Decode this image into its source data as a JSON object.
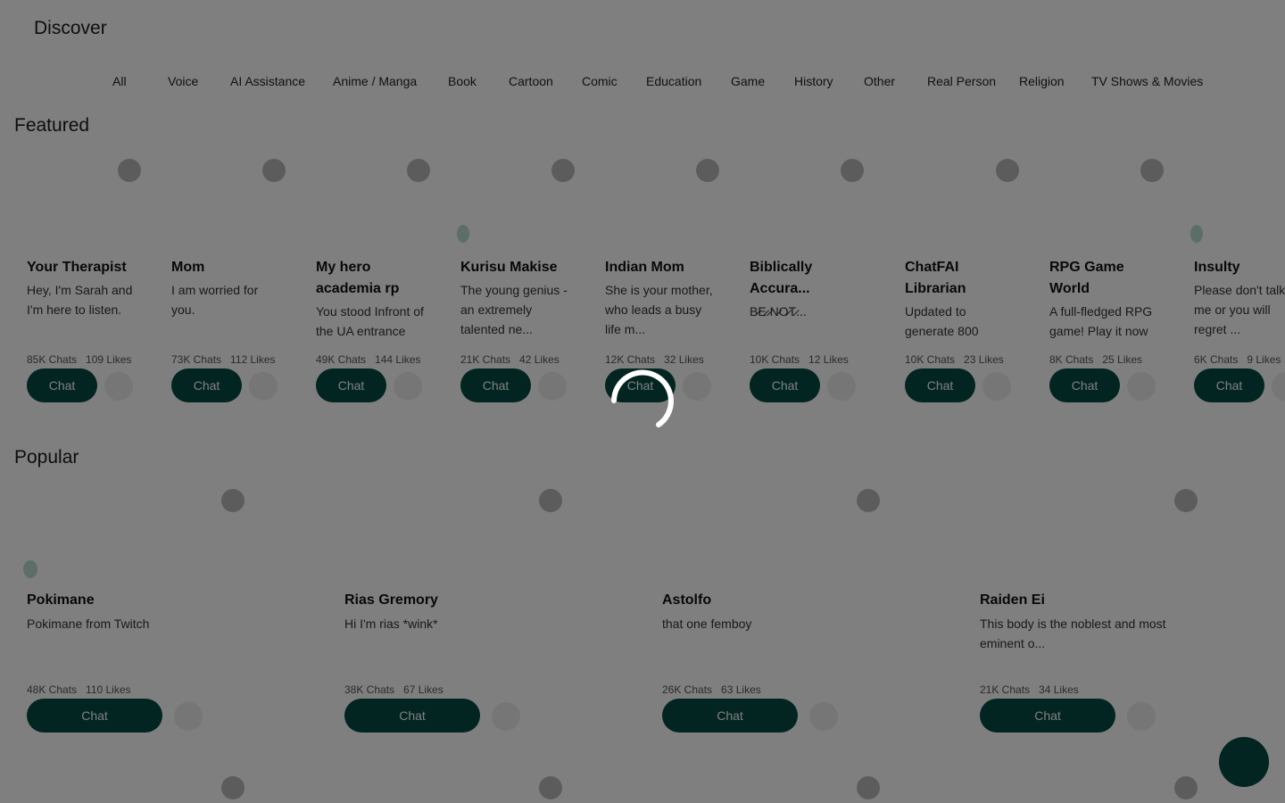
{
  "header": {
    "title": "Discover"
  },
  "categories": [
    "All",
    "Voice",
    "AI Assistance",
    "Anime / Manga",
    "Book",
    "Cartoon",
    "Comic",
    "Education",
    "Game",
    "History",
    "Other",
    "Real Person",
    "Religion",
    "TV Shows & Movies"
  ],
  "featured": {
    "title": "Featured",
    "chat_label": "Chat",
    "items": [
      {
        "name": "Your Therapist",
        "desc": "Hey, I'm Sarah and I'm here to listen.",
        "chats": "85K Chats",
        "likes": "109 Likes"
      },
      {
        "name": "Mom",
        "desc": "I am worried for you.",
        "chats": "73K Chats",
        "likes": "112 Likes"
      },
      {
        "name": "My hero academia rp",
        "desc": "You stood Infront of the UA entrance",
        "chats": "49K Chats",
        "likes": "144 Likes"
      },
      {
        "name": "Kurisu Makise",
        "desc": "The young genius - an extremely talented ne...",
        "chats": "21K Chats",
        "likes": "42 Likes"
      },
      {
        "name": "Indian Mom",
        "desc": "She is your mother, who leads a busy life m...",
        "chats": "12K Chats",
        "likes": "32 Likes"
      },
      {
        "name": "Biblically Accura...",
        "desc": "B̷E̷ ̷N̷O̷T̷...",
        "chats": "10K Chats",
        "likes": "12 Likes"
      },
      {
        "name": "ChatFAI Librarian",
        "desc": "Updated to generate 800",
        "chats": "10K Chats",
        "likes": "23 Likes"
      },
      {
        "name": "RPG Game World",
        "desc": "A full-fledged RPG game! Play it now",
        "chats": "8K Chats",
        "likes": "25 Likes"
      },
      {
        "name": "Insulty",
        "desc": "Please don't talk to me or you will regret ...",
        "chats": "6K Chats",
        "likes": "9 Likes"
      }
    ]
  },
  "popular": {
    "title": "Popular",
    "chat_label": "Chat",
    "items": [
      {
        "name": "Pokimane",
        "desc": "Pokimane from Twitch",
        "chats": "48K Chats",
        "likes": "110 Likes"
      },
      {
        "name": "Rias Gremory",
        "desc": "Hi I'm rias *wink*",
        "chats": "38K Chats",
        "likes": "67 Likes"
      },
      {
        "name": "Astolfo",
        "desc": "that one femboy",
        "chats": "26K Chats",
        "likes": "63 Likes"
      },
      {
        "name": "Raiden Ei",
        "desc": "This body is the noblest and most eminent o...",
        "chats": "21K Chats",
        "likes": "34 Likes"
      }
    ]
  },
  "colors": {
    "accent": "#044a44",
    "online": "#b7ded0",
    "overlay": "rgba(0,0,0,0.5)"
  },
  "icons": {
    "favorite": "heart-icon",
    "more": "more-icon",
    "fab": "chat-bubble-icon",
    "loading": "spinner-icon"
  }
}
